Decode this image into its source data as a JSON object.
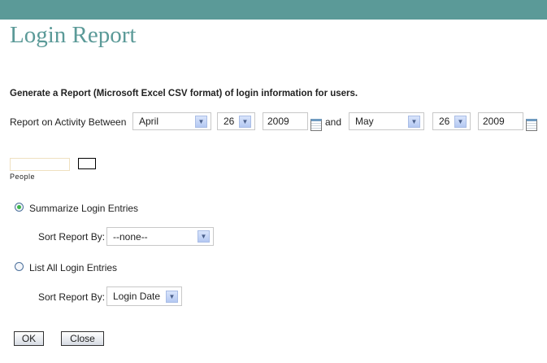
{
  "header": {
    "title": "Login Report"
  },
  "description": "Generate a Report (Microsoft Excel CSV format) of login information for users.",
  "range": {
    "label": "Report on Activity Between",
    "and_label": "and",
    "start": {
      "month": "April",
      "day": "26",
      "year": "2009"
    },
    "end": {
      "month": "May",
      "day": "26",
      "year": "2009"
    }
  },
  "people": {
    "label": "People",
    "value": ""
  },
  "options": {
    "summarize": {
      "label": "Summarize Login Entries",
      "selected": true,
      "sort_label": "Sort Report By:",
      "sort_value": "--none--"
    },
    "list_all": {
      "label": "List All Login Entries",
      "selected": false,
      "sort_label": "Sort Report By:",
      "sort_value": "Login Date"
    }
  },
  "buttons": {
    "ok": "OK",
    "close": "Close"
  },
  "colors": {
    "accent": "#5b9a98"
  }
}
